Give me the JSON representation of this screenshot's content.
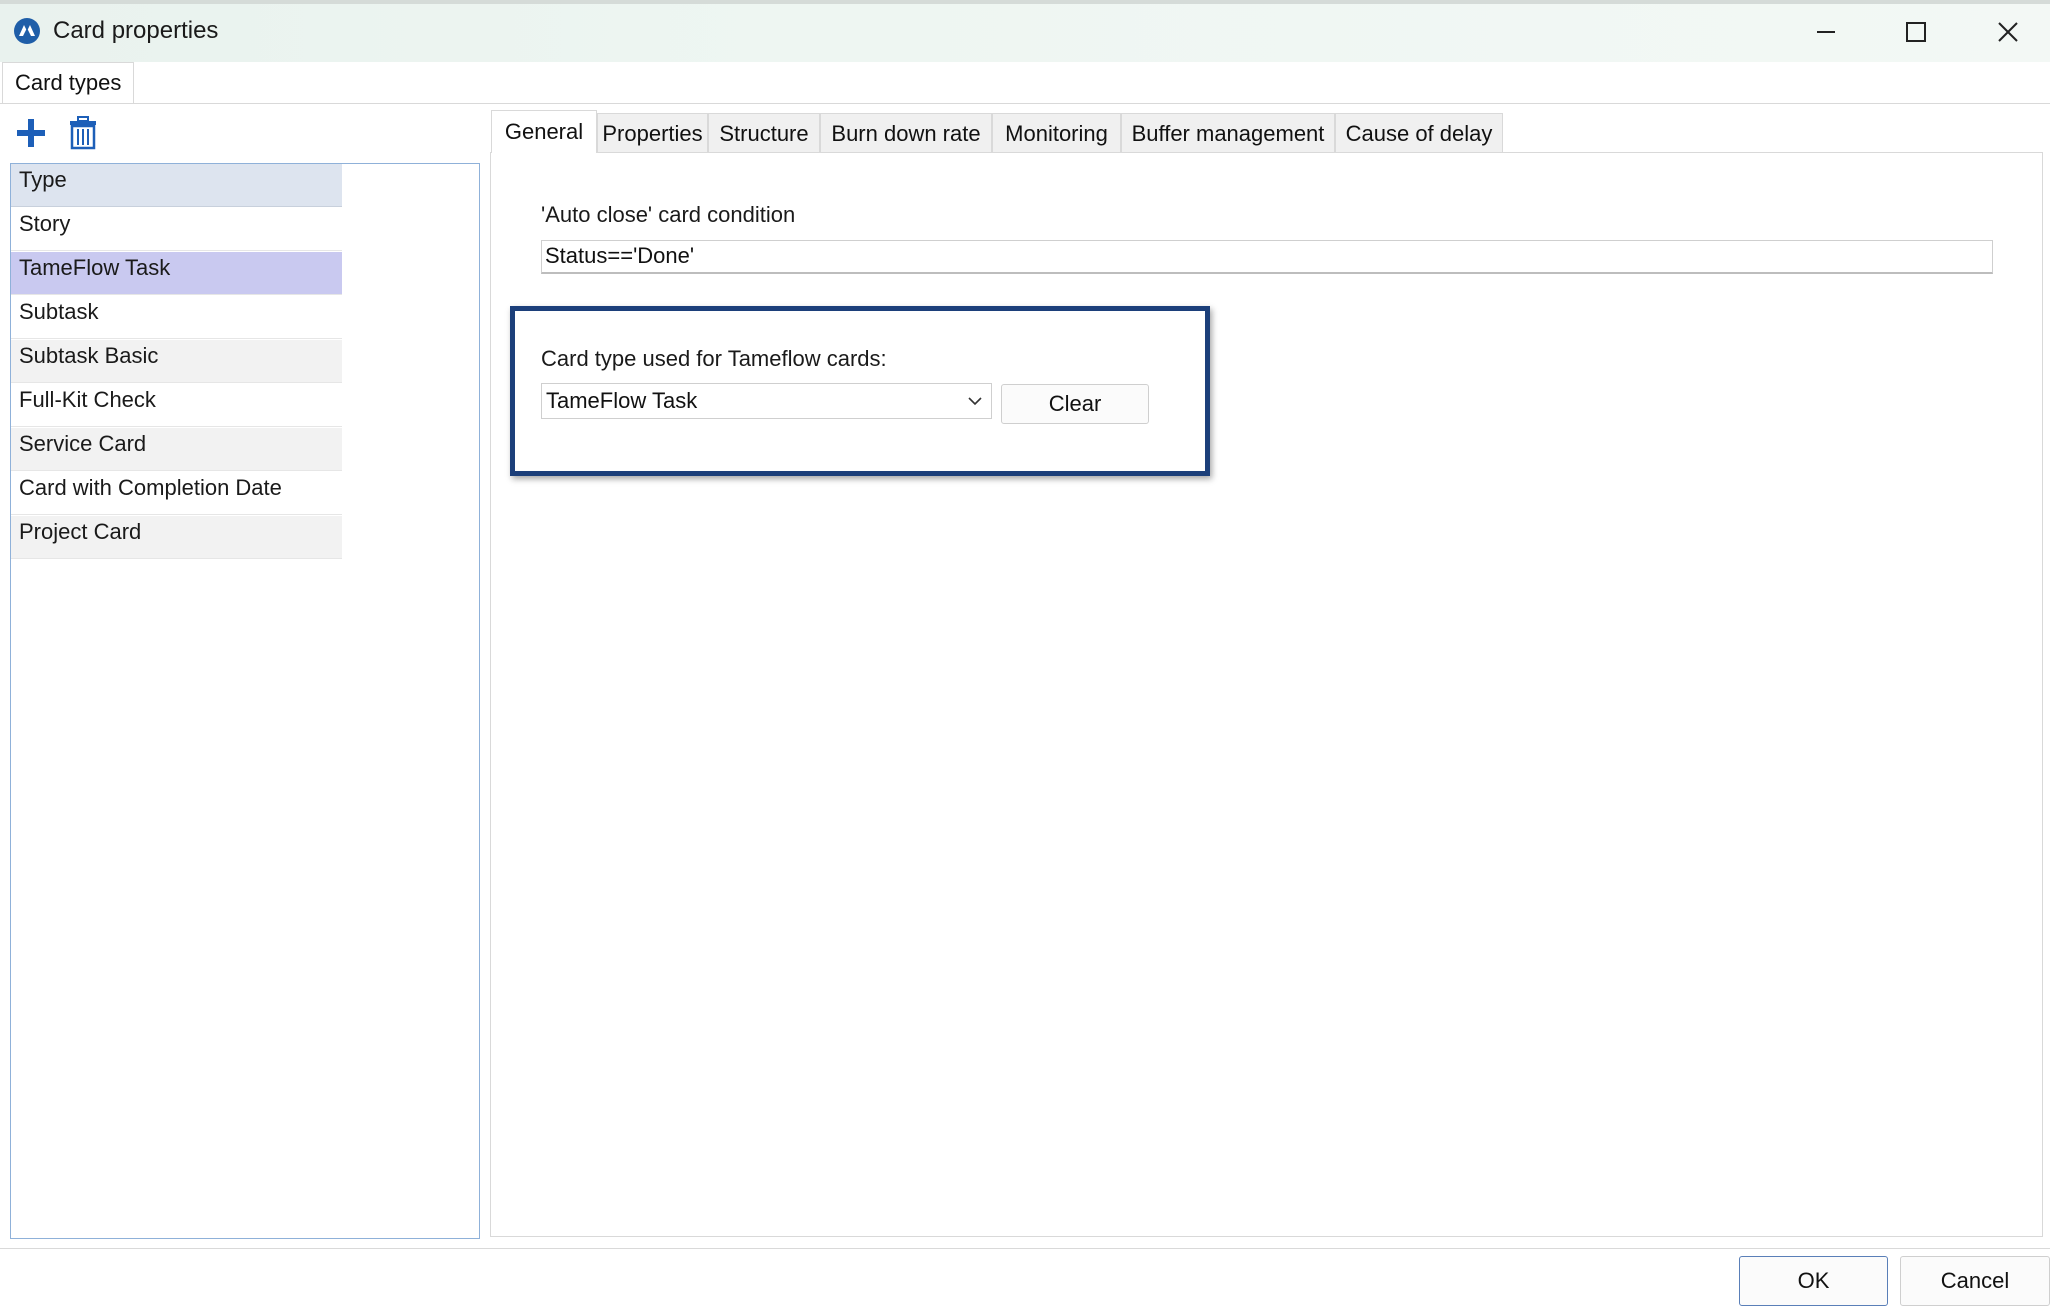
{
  "window": {
    "title": "Card properties",
    "controls": {
      "minimize": "minimize-icon",
      "maximize": "maximize-icon",
      "close": "close-icon"
    }
  },
  "outer_tabs": [
    {
      "label": "Card types",
      "active": true
    }
  ],
  "toolbar": {
    "add_icon": "plus-icon",
    "delete_icon": "trash-icon",
    "accent": "#1d5fb8"
  },
  "card_list": {
    "header": "Type",
    "items": [
      {
        "label": "Story",
        "selected": false
      },
      {
        "label": "TameFlow Task",
        "selected": true
      },
      {
        "label": "Subtask",
        "selected": false
      },
      {
        "label": "Subtask Basic",
        "selected": false
      },
      {
        "label": "Full-Kit Check",
        "selected": false
      },
      {
        "label": "Service Card",
        "selected": false
      },
      {
        "label": "Card with Completion Date",
        "selected": false
      },
      {
        "label": "Project Card",
        "selected": false
      }
    ]
  },
  "detail_tabs": [
    {
      "label": "General",
      "active": true
    },
    {
      "label": "Properties",
      "active": false
    },
    {
      "label": "Structure",
      "active": false
    },
    {
      "label": "Burn down rate",
      "active": false
    },
    {
      "label": "Monitoring",
      "active": false
    },
    {
      "label": "Buffer management",
      "active": false
    },
    {
      "label": "Cause of delay",
      "active": false
    }
  ],
  "general": {
    "auto_close_label": "'Auto close' card condition",
    "auto_close_value": "Status=='Done'",
    "tameflow_label": "Card type used for Tameflow cards:",
    "tameflow_value": "TameFlow Task",
    "clear_label": "Clear",
    "highlight_color": "#1c3f7a"
  },
  "footer": {
    "ok_label": "OK",
    "cancel_label": "Cancel"
  },
  "colors": {
    "selected_row": "#c9c9f0",
    "header_row": "#dde4ef",
    "list_border": "#8fb1d9"
  }
}
